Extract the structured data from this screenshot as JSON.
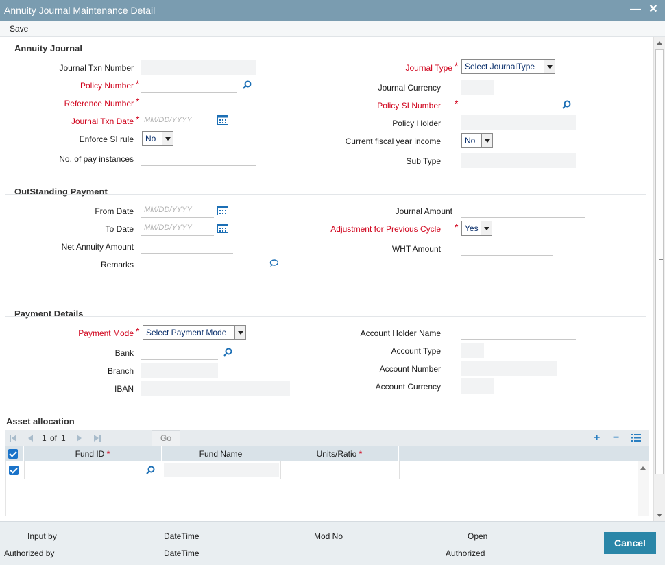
{
  "window": {
    "title": "Annuity Journal Maintenance Detail",
    "minimize_glyph": "—",
    "close_glyph": "✕"
  },
  "menu": {
    "save_label": "Save"
  },
  "annuity_journal": {
    "section_title": "Annuity Journal",
    "journal_txn_number_label": "Journal Txn Number",
    "policy_number_label": "Policy Number",
    "reference_number_label": "Reference Number",
    "journal_txn_date_label": "Journal Txn Date",
    "journal_txn_date_placeholder": "MM/DD/YYYY",
    "enforce_si_rule_label": "Enforce SI rule",
    "enforce_si_rule_value": "No",
    "no_of_pay_instances_label": "No. of pay instances",
    "journal_type_label": "Journal Type",
    "journal_type_value": "Select JournalType",
    "journal_currency_label": "Journal Currency",
    "policy_si_number_label": "Policy SI Number",
    "policy_holder_label": "Policy Holder",
    "current_fiscal_year_income_label": "Current fiscal year income",
    "current_fiscal_year_income_value": "No",
    "sub_type_label": "Sub Type"
  },
  "outstanding_payment": {
    "section_title": "OutStanding Payment",
    "from_date_label": "From Date",
    "from_date_placeholder": "MM/DD/YYYY",
    "to_date_label": "To Date",
    "to_date_placeholder": "MM/DD/YYYY",
    "net_annuity_amount_label": "Net Annuity Amount",
    "remarks_label": "Remarks",
    "journal_amount_label": "Journal Amount",
    "adjustment_label": "Adjustment for Previous Cycle",
    "adjustment_value": "Yes",
    "wht_amount_label": "WHT Amount"
  },
  "payment_details": {
    "section_title": "Payment Details",
    "payment_mode_label": "Payment Mode",
    "payment_mode_value": "Select Payment Mode",
    "bank_label": "Bank",
    "branch_label": "Branch",
    "iban_label": "IBAN",
    "account_holder_name_label": "Account Holder Name",
    "account_type_label": "Account Type",
    "account_number_label": "Account Number",
    "account_currency_label": "Account Currency"
  },
  "required_mark": "*",
  "asset_allocation": {
    "section_title": "Asset allocation",
    "pagination": {
      "current": "1",
      "of_label": "of",
      "total": "1"
    },
    "go_label": "Go",
    "add_glyph": "+",
    "remove_glyph": "−",
    "columns": [
      "Fund ID",
      "Fund Name",
      "Units/Ratio"
    ]
  },
  "footer": {
    "input_by_label": "Input by",
    "datetime_label_1": "DateTime",
    "mod_no_label": "Mod No",
    "open_label": "Open",
    "authorized_by_label": "Authorized by",
    "datetime_label_2": "DateTime",
    "authorized_label": "Authorized",
    "cancel_label": "Cancel"
  },
  "colors": {
    "titlebar": "#7a9cb0",
    "required": "#d0021b",
    "cancel_button": "#2a86a8",
    "footer_bg": "#e9eef1"
  },
  "icons": [
    "search-icon",
    "calendar-icon",
    "comment-icon",
    "first-page-icon",
    "prev-page-icon",
    "next-page-icon",
    "last-page-icon",
    "add-row-icon",
    "delete-row-icon",
    "columns-icon",
    "checkbox-icon"
  ]
}
